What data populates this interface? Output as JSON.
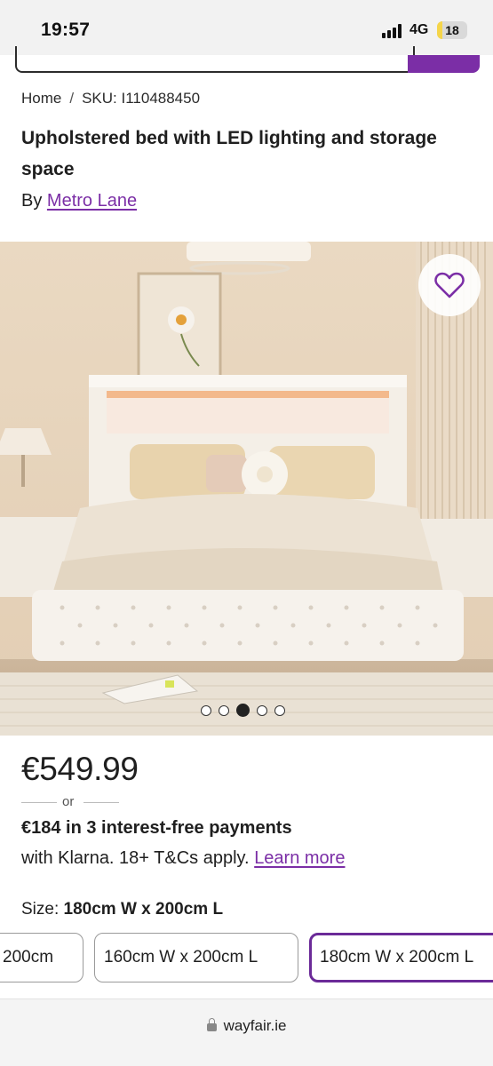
{
  "status_bar": {
    "time": "19:57",
    "network": "4G",
    "battery": "18",
    "battery_level": 0.18
  },
  "breadcrumb": {
    "home": "Home",
    "separator": "/",
    "sku": "SKU: I110488450"
  },
  "product": {
    "title": "Upholstered bed with LED lighting and storage space",
    "by_prefix": "By",
    "brand": "Metro Lane",
    "image_count": 5,
    "active_image_index": 2,
    "price": "€549.99",
    "or_text": "or",
    "installment_text": "€184 in 3 interest-free payments",
    "klarna_text": "with Klarna. 18+ T&Cs apply.",
    "learn_more": "Learn more"
  },
  "size": {
    "label": "Size:",
    "selected": "180cm W x 200cm L",
    "options": [
      {
        "label": "200cm"
      },
      {
        "label": "160cm W x 200cm L"
      },
      {
        "label": "180cm W x 200cm L"
      }
    ]
  },
  "browser": {
    "url": "wayfair.ie"
  },
  "colors": {
    "accent": "#7b2ea6",
    "selected_border": "#6b2a98"
  },
  "icons": {
    "favorite": "heart-icon",
    "lock": "lock-icon"
  }
}
